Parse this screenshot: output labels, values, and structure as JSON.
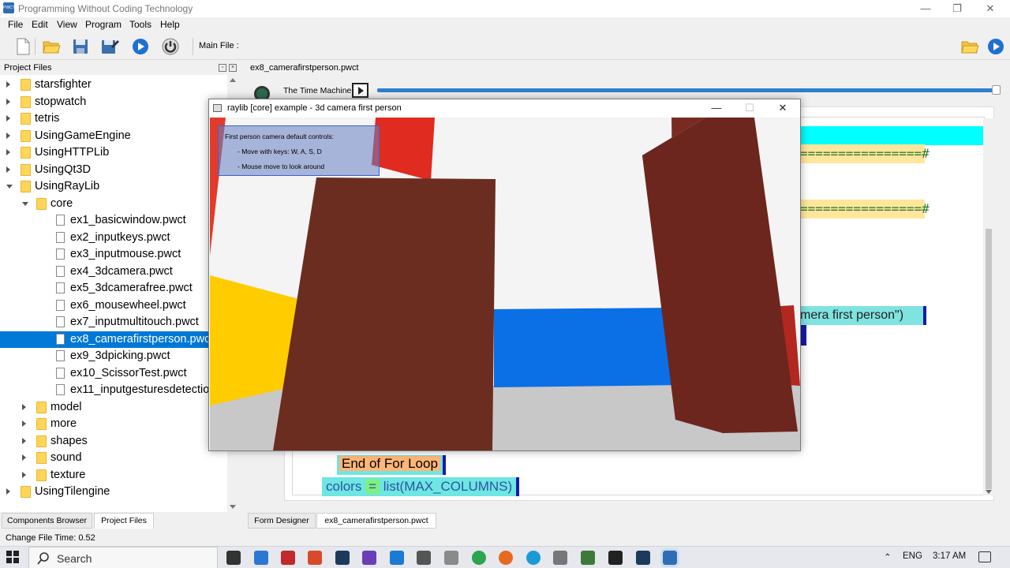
{
  "window": {
    "title": "Programming Without Coding Technology",
    "app_icon_text": "PWCT"
  },
  "menu": {
    "items": [
      "File",
      "Edit",
      "View",
      "Program",
      "Tools",
      "Help"
    ]
  },
  "toolbar": {
    "main_file_label": "Main File :"
  },
  "project_panel": {
    "title": "Project Files",
    "tree": [
      {
        "label": "starsfighter",
        "type": "folder",
        "level": 0,
        "expanded": false
      },
      {
        "label": "stopwatch",
        "type": "folder",
        "level": 0,
        "expanded": false
      },
      {
        "label": "tetris",
        "type": "folder",
        "level": 0,
        "expanded": false
      },
      {
        "label": "UsingGameEngine",
        "type": "folder",
        "level": 0,
        "expanded": false
      },
      {
        "label": "UsingHTTPLib",
        "type": "folder",
        "level": 0,
        "expanded": false
      },
      {
        "label": "UsingQt3D",
        "type": "folder",
        "level": 0,
        "expanded": false
      },
      {
        "label": "UsingRayLib",
        "type": "folder",
        "level": 0,
        "expanded": true
      },
      {
        "label": "core",
        "type": "folder",
        "level": 1,
        "expanded": true
      },
      {
        "label": "ex1_basicwindow.pwct",
        "type": "file",
        "level": 2
      },
      {
        "label": "ex2_inputkeys.pwct",
        "type": "file",
        "level": 2
      },
      {
        "label": "ex3_inputmouse.pwct",
        "type": "file",
        "level": 2
      },
      {
        "label": "ex4_3dcamera.pwct",
        "type": "file",
        "level": 2
      },
      {
        "label": "ex5_3dcamerafree.pwct",
        "type": "file",
        "level": 2
      },
      {
        "label": "ex6_mousewheel.pwct",
        "type": "file",
        "level": 2
      },
      {
        "label": "ex7_inputmultitouch.pwct",
        "type": "file",
        "level": 2
      },
      {
        "label": "ex8_camerafirstperson.pwct",
        "type": "file",
        "level": 2,
        "selected": true
      },
      {
        "label": "ex9_3dpicking.pwct",
        "type": "file",
        "level": 2
      },
      {
        "label": "ex10_ScissorTest.pwct",
        "type": "file",
        "level": 2
      },
      {
        "label": "ex11_inputgesturesdetection",
        "type": "file",
        "level": 2
      },
      {
        "label": "model",
        "type": "folder",
        "level": 1,
        "expanded": false
      },
      {
        "label": "more",
        "type": "folder",
        "level": 1,
        "expanded": false
      },
      {
        "label": "shapes",
        "type": "folder",
        "level": 1,
        "expanded": false
      },
      {
        "label": "sound",
        "type": "folder",
        "level": 1,
        "expanded": false
      },
      {
        "label": "texture",
        "type": "folder",
        "level": 1,
        "expanded": false
      },
      {
        "label": "UsingTilengine",
        "type": "folder",
        "level": 0,
        "expanded": false
      }
    ],
    "tabs": [
      "Components Browser",
      "Project Files"
    ]
  },
  "statusbar": {
    "text": "Change File Time: 0.52"
  },
  "editor": {
    "file_tab": "ex8_camerafirstperson.pwct",
    "time_machine_label": "The Time Machine",
    "time_machine_position": 1.0,
    "hash_text": "================#",
    "camera_text": "mera first person\")",
    "end_for_loop": "End of For Loop",
    "colors_var": "colors",
    "colors_eq": "=",
    "colors_call": "list(MAX_COLUMNS)",
    "bottom_tabs": [
      "Form Designer",
      "ex8_camerafirstperson.pwct"
    ]
  },
  "raylib_window": {
    "title": "raylib [core] example - 3d camera first person",
    "overlay_lines": [
      "First person camera default controls:",
      "- Move with keys: W, A, S, D",
      "- Mouse move to look around"
    ]
  },
  "taskbar": {
    "search_label": "Search",
    "language": "ENG",
    "time": "3:17 AM",
    "colors": {
      "accent": "#0078d7"
    }
  }
}
